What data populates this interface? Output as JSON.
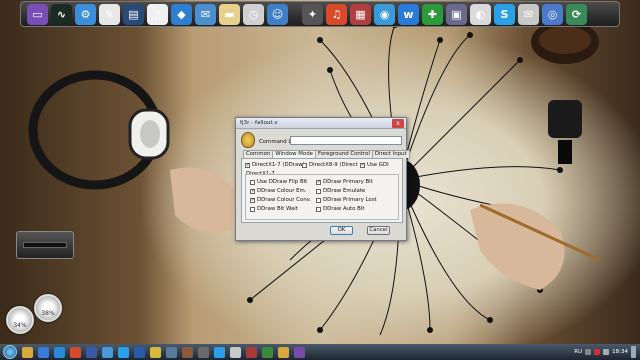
{
  "dialog": {
    "title": "fj3r - fallout.v",
    "close_glyph": "x",
    "command_label": "Command Line",
    "command_value": "",
    "tabs": [
      {
        "label": "Common"
      },
      {
        "label": "Window Mode"
      },
      {
        "label": "Foreground Control"
      },
      {
        "label": "Direct Input"
      }
    ],
    "top_options": [
      {
        "label": "DirectX1-7 (DDraw)",
        "checked": true
      },
      {
        "label": "DirectX8-9 (Direct",
        "checked": false
      },
      {
        "label": "Use GDI",
        "checked": true
      }
    ],
    "group_label": "DirectX1-7",
    "options_left": [
      {
        "label": "Use DDraw Flip Blt",
        "checked": false
      },
      {
        "label": "DDraw Colour Em.",
        "checked": true
      },
      {
        "label": "DDraw Colour Conv.",
        "checked": true
      },
      {
        "label": "DDraw Blt Wait",
        "checked": false
      }
    ],
    "options_right": [
      {
        "label": "DDraw Primary Blt",
        "checked": true
      },
      {
        "label": "DDraw Emulate",
        "checked": false
      },
      {
        "label": "DDraw Primary Lost",
        "checked": false
      },
      {
        "label": "DDraw Auto Blt",
        "checked": false
      }
    ],
    "ok_label": "OK",
    "cancel_label": "Cancel"
  },
  "dock": {
    "icons": [
      {
        "name": "laptop-icon",
        "color": "#7a4fb5",
        "glyph": "▭"
      },
      {
        "name": "activity-monitor-icon",
        "color": "#1c2a22",
        "glyph": "∿"
      },
      {
        "name": "settings-icon",
        "color": "#3a8fd8",
        "glyph": "⚙"
      },
      {
        "name": "notes-icon",
        "color": "#e8e8e8",
        "glyph": "✎"
      },
      {
        "name": "trash-icon",
        "color": "#2a4a7a",
        "glyph": "▤"
      },
      {
        "name": "document-icon",
        "color": "#f0f0f0",
        "glyph": "▯"
      },
      {
        "name": "dropbox-icon",
        "color": "#2f7fd0",
        "glyph": "◆"
      },
      {
        "name": "mail-icon",
        "color": "#4a90d0",
        "glyph": "✉"
      },
      {
        "name": "folder-icon",
        "color": "#e8d08a",
        "glyph": "▬"
      },
      {
        "name": "clock-icon",
        "color": "#d0d0d0",
        "glyph": "◷"
      },
      {
        "name": "finder-icon",
        "color": "#3e7fc8",
        "glyph": "☺"
      },
      {
        "name": "system-prefs-icon",
        "color": "#555",
        "glyph": "✦"
      },
      {
        "name": "music-icon",
        "color": "#d84a2a",
        "glyph": "♫"
      },
      {
        "name": "calendar-icon",
        "color": "#b04040",
        "glyph": "▦"
      },
      {
        "name": "browser-icon",
        "color": "#3a9ad8",
        "glyph": "◉"
      },
      {
        "name": "vk-icon",
        "color": "#2a7ad8",
        "glyph": "w"
      },
      {
        "name": "game-icon",
        "color": "#2a9a3a",
        "glyph": "✚"
      },
      {
        "name": "monitor-icon",
        "color": "#6a6a8a",
        "glyph": "▣"
      },
      {
        "name": "photo-icon",
        "color": "#dadada",
        "glyph": "◐"
      },
      {
        "name": "skype-icon",
        "color": "#2aa0e8",
        "glyph": "S"
      },
      {
        "name": "mail-app-icon",
        "color": "#c8c8c8",
        "glyph": "✉"
      },
      {
        "name": "web-icon",
        "color": "#4a7ac8",
        "glyph": "◎"
      },
      {
        "name": "sync-icon",
        "color": "#3a8a5a",
        "glyph": "⟳"
      }
    ]
  },
  "widgets": {
    "gauge_left": "34%",
    "gauge_right": "38%"
  },
  "taskbar": {
    "icons": [
      {
        "name": "folder-icon",
        "color": "#d8a83a"
      },
      {
        "name": "ie-icon",
        "color": "#3a7ad8"
      },
      {
        "name": "media-player-icon",
        "color": "#2a8ad8"
      },
      {
        "name": "music-icon",
        "color": "#d84a2a"
      },
      {
        "name": "app-icon",
        "color": "#3a5aa8"
      },
      {
        "name": "chat-icon",
        "color": "#4a9ad8"
      },
      {
        "name": "skype-icon",
        "color": "#2aa0e8"
      },
      {
        "name": "word-icon",
        "color": "#2a5aa8"
      },
      {
        "name": "chrome-icon",
        "color": "#d8b83a"
      },
      {
        "name": "network-icon",
        "color": "#5a7a9a"
      },
      {
        "name": "tool-icon",
        "color": "#8a5a3a"
      },
      {
        "name": "gear-icon",
        "color": "#6a6a6a"
      },
      {
        "name": "skype-icon",
        "color": "#2aa0e8"
      },
      {
        "name": "mail-icon",
        "color": "#c8c8c8"
      },
      {
        "name": "app-icon",
        "color": "#a83a3a"
      },
      {
        "name": "app-icon",
        "color": "#3a8a3a"
      },
      {
        "name": "app-icon",
        "color": "#d8a83a"
      },
      {
        "name": "app-icon",
        "color": "#7a4aa8"
      }
    ],
    "language": "RU",
    "clock": "18:34"
  }
}
